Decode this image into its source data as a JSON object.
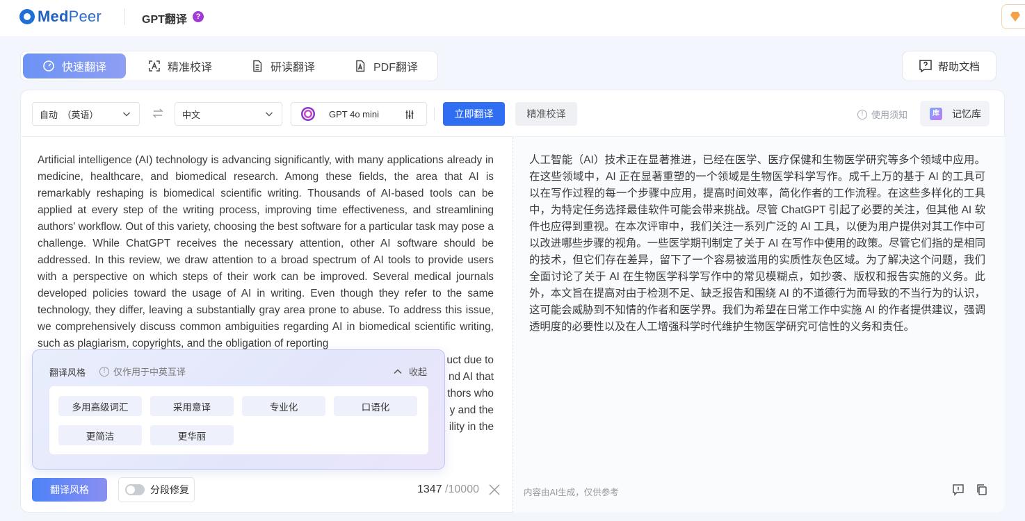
{
  "header": {
    "brand_bold": "Med",
    "brand_thin": "Peer",
    "app_title": "GPT翻译",
    "help_mark": "?"
  },
  "tabs": [
    {
      "label": "快速翻译",
      "icon": "speedometer-icon",
      "active": true
    },
    {
      "label": "精准校译",
      "icon": "scan-text-icon",
      "active": false
    },
    {
      "label": "研读翻译",
      "icon": "document-icon",
      "active": false
    },
    {
      "label": "PDF翻译",
      "icon": "pdf-icon",
      "active": false
    }
  ],
  "help_doc": {
    "label": "帮助文档",
    "icon": "help-chat-icon"
  },
  "toolbar": {
    "source_lang": "自动　（英语）",
    "target_lang": "中文",
    "model": "GPT 4o mini",
    "translate_now": "立即翻译",
    "precise_proof": "精准校译",
    "usage_notice": "使用须知",
    "memory_lib": "记忆库",
    "memory_lib_badge": "库"
  },
  "source_text": "Artificial intelligence (AI) technology is advancing significantly, with many applications already in medicine, healthcare, and biomedical research. Among these fields, the area that AI is remarkably reshaping is biomedical scientific writing. Thousands of AI-based tools can be applied at every step of the writing process, improving time effectiveness, and streamlining authors' workflow. Out of this variety, choosing the best software for a particular task may pose a challenge. While ChatGPT receives the necessary attention, other AI software should be addressed. In this review, we draw attention to a broad spectrum of AI tools to provide users with a perspective on which steps of their work can be improved. Several medical journals developed policies toward the usage of AI in writing. Even though they refer to the same technology, they differ, leaving a substantially gray area prone to abuse. To address this issue, we comprehensively discuss common ambiguities regarding AI in biomedical scientific writing, such as plagiarism, copyrights, and the obligation of reporting",
  "source_tail": [
    "uct due to",
    "nd AI that",
    "thors who",
    "y and the",
    "ility in the"
  ],
  "target_text": "人工智能（AI）技术正在显著推进，已经在医学、医疗保健和生物医学研究等多个领域中应用。在这些领域中，AI 正在显著重塑的一个领域是生物医学科学写作。成千上万的基于 AI 的工具可以在写作过程的每一个步骤中应用，提高时间效率，简化作者的工作流程。在这些多样化的工具中，为特定任务选择最佳软件可能会带来挑战。尽管 ChatGPT 引起了必要的关注，但其他 AI 软件也应得到重视。在本次评审中，我们关注一系列广泛的 AI 工具，以便为用户提供对其工作中可以改进哪些步骤的视角。一些医学期刊制定了关于 AI 在写作中使用的政策。尽管它们指的是相同的技术，但它们存在差异，留下了一个容易被滥用的实质性灰色区域。为了解决这个问题，我们全面讨论了关于 AI 在生物医学科学写作中的常见模糊点，如抄袭、版权和报告实施的义务。此外，本文旨在提高对由于检测不足、缺乏报告和围绕 AI 的不道德行为而导致的不当行为的认识，这可能会威胁到不知情的作者和医学界。我们为希望在日常工作中实施 AI 的作者提供建议，强调透明度的必要性以及在人工增强科学时代维护生物医学研究可信性的义务和责任。",
  "style_popup": {
    "title": "翻译风格",
    "info": "仅作用于中英互译",
    "collapse": "收起",
    "options": [
      "多用高级词汇",
      "采用意译",
      "专业化",
      "口语化",
      "更简洁",
      "更华丽"
    ]
  },
  "bottom": {
    "style_button": "翻译风格",
    "segment_fix": "分段修复",
    "char_count": "1347",
    "char_max": "/10000",
    "disclaimer": "内容由AI生成，仅供参考"
  }
}
